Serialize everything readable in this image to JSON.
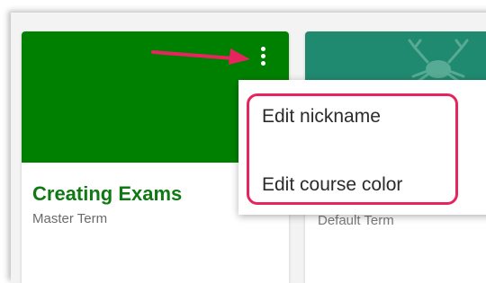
{
  "cards": [
    {
      "title": "Creating Exams",
      "term": "Master Term",
      "color": "#008000",
      "menu_icon": "kebab-menu-icon"
    },
    {
      "title": "",
      "term": "Default Term",
      "color": "#1f8a6f",
      "decoration_icon": "crab-icon"
    }
  ],
  "menu": {
    "items": [
      {
        "label": "Edit nickname"
      },
      {
        "label": "Edit course color"
      }
    ]
  },
  "annotation": {
    "arrow_color": "#e8245f",
    "highlight_color": "#e8245f"
  }
}
